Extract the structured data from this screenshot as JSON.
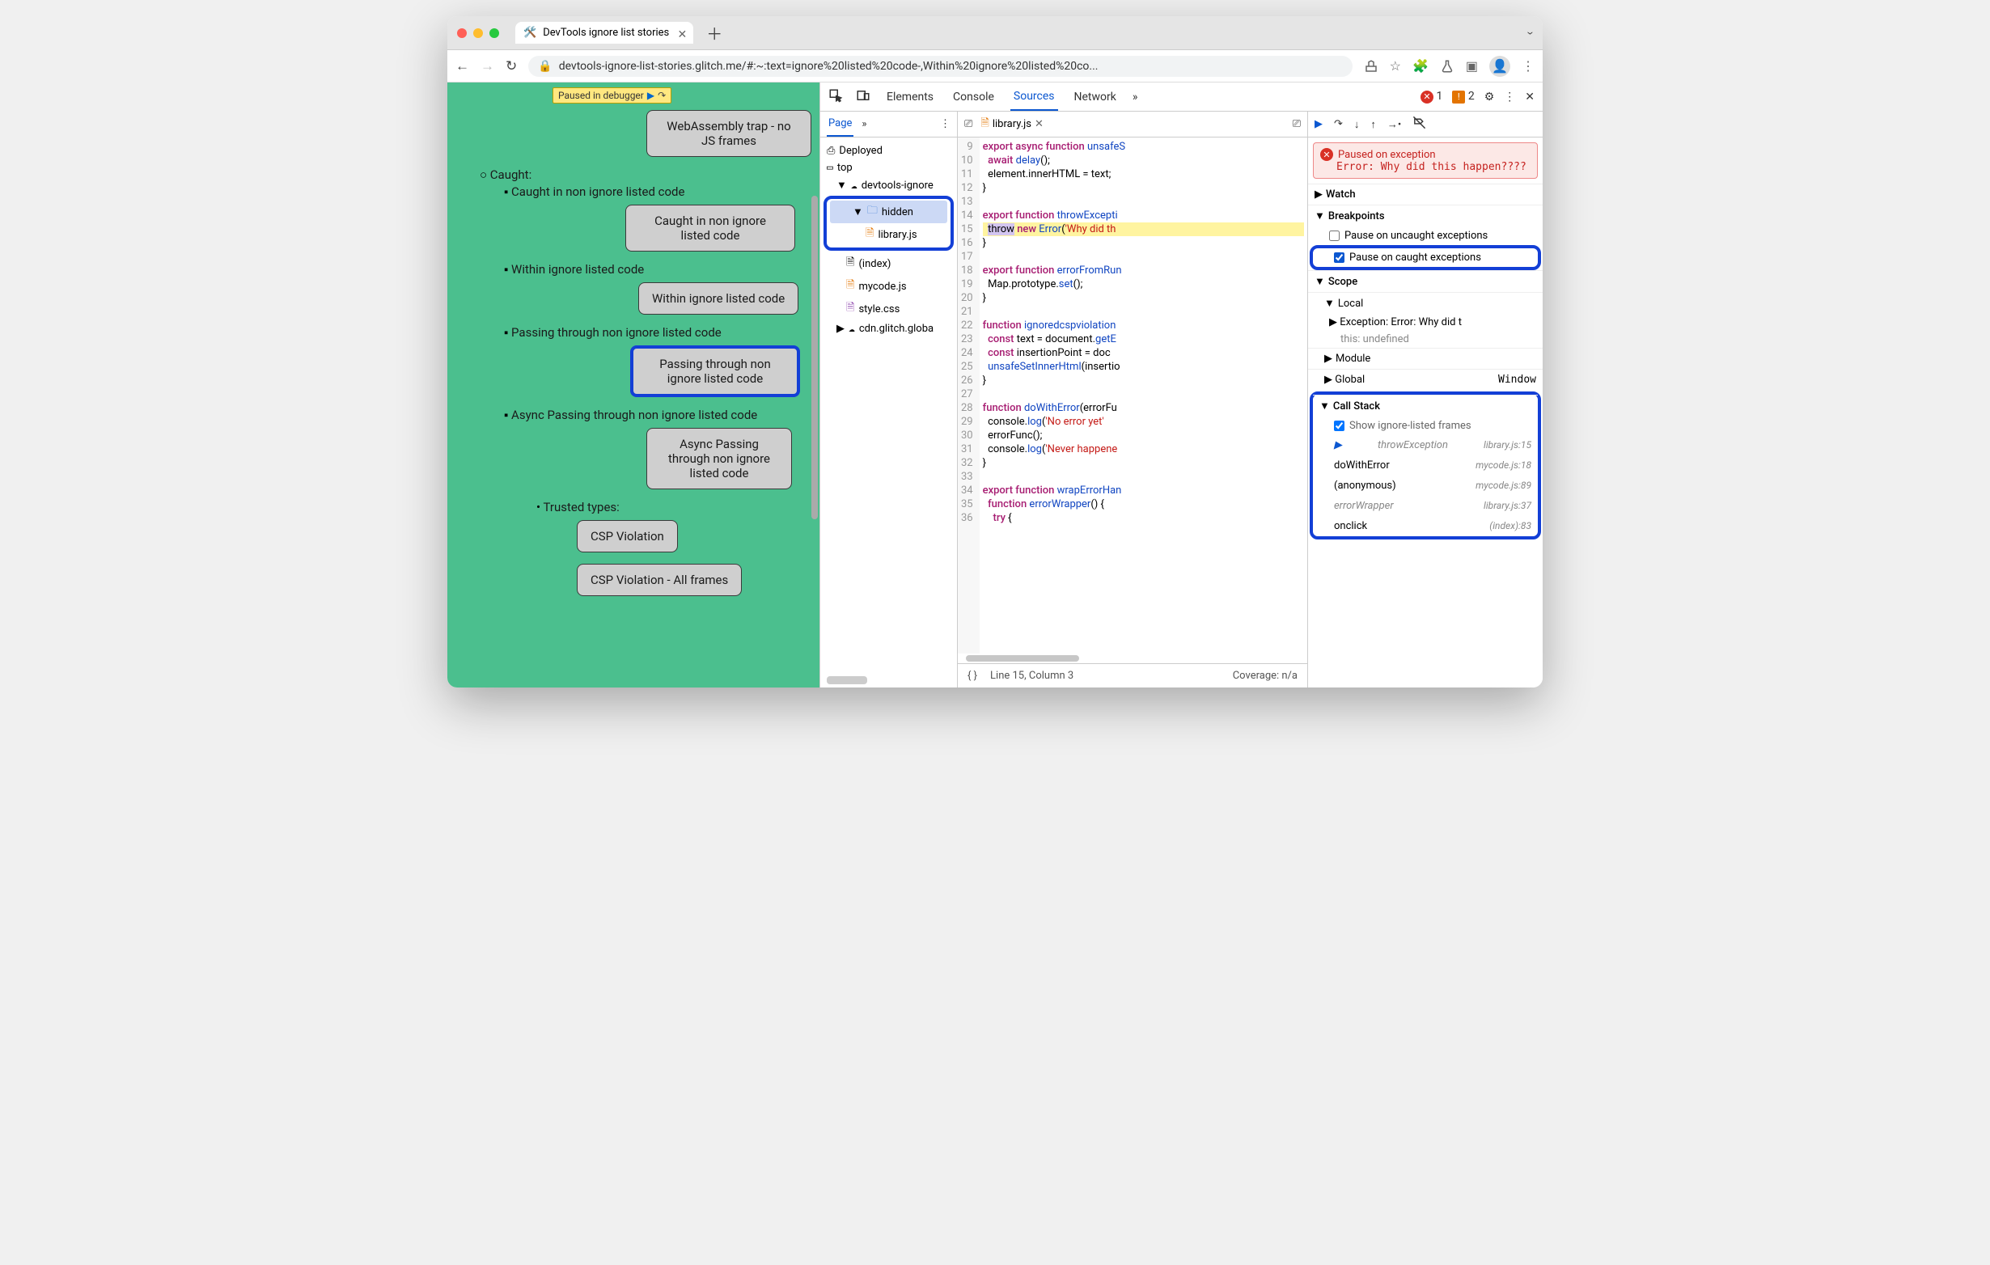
{
  "window": {
    "tab_title": "DevTools ignore list stories",
    "url": "devtools-ignore-list-stories.glitch.me/#:~:text=ignore%20listed%20code-,Within%20ignore%20listed%20co..."
  },
  "paused_overlay": "Paused in debugger",
  "page": {
    "wasm": "WebAssembly trap - no JS frames",
    "caught_hdr": "Caught:",
    "i1_text": "Caught in non ignore listed code",
    "i1_btn": "Caught in non ignore listed code",
    "i2_text": "Within ignore listed code",
    "i2_btn": "Within ignore listed code",
    "i3_text": "Passing through non ignore listed code",
    "i3_btn": "Passing through non ignore listed code",
    "i4_text": "Async Passing through non ignore listed code",
    "i4_btn": "Async Passing through non ignore listed code",
    "tt_hdr": "Trusted types:",
    "tt1": "CSP Violation",
    "tt2": "CSP Violation - All frames"
  },
  "devtools": {
    "tabs": {
      "elements": "Elements",
      "console": "Console",
      "sources": "Sources",
      "network": "Network"
    },
    "errors": "1",
    "warnings": "2"
  },
  "navigator": {
    "page_tab": "Page",
    "deployed": "Deployed",
    "top": "top",
    "origin": "devtools-ignore",
    "hidden": "hidden",
    "library": "library.js",
    "index": "(index)",
    "mycode": "mycode.js",
    "style": "style.css",
    "cdn": "cdn.glitch.globa"
  },
  "editor": {
    "file": "library.js",
    "lines": {
      "9": "export async function unsafeS",
      "10": "  await delay();",
      "11": "  element.innerHTML = text;",
      "12": "}",
      "13": "",
      "14": "export function throwExcepti",
      "15": "  throw new Error('Why did th",
      "16": "}",
      "17": "",
      "18": "export function errorFromRun",
      "19": "  Map.prototype.set();",
      "20": "}",
      "21": "",
      "22": "function ignoredcspviolation",
      "23": "  const text = document.getE",
      "24": "  const insertionPoint = doc",
      "25": "  unsafeSetInnerHtml(insertio",
      "26": "}",
      "27": "",
      "28": "function doWithError(errorFu",
      "29": "  console.log('No error yet'",
      "30": "  errorFunc();",
      "31": "  console.log('Never happene",
      "32": "}",
      "33": "",
      "34": "export function wrapErrorHan",
      "35": "  function errorWrapper() {",
      "36": "    try {"
    },
    "status_line": "Line 15, Column 3",
    "coverage": "Coverage: n/a"
  },
  "debug": {
    "paused_title": "Paused on exception",
    "paused_err": "Error: Why did this happen????",
    "watch": "Watch",
    "breakpoints": "Breakpoints",
    "bp_uncaught": "Pause on uncaught exceptions",
    "bp_caught": "Pause on caught exceptions",
    "scope": "Scope",
    "local": "Local",
    "exception": "Exception: Error: Why did t",
    "this_v": "this: undefined",
    "module": "Module",
    "global": "Global",
    "global_v": "Window",
    "callstack": "Call Stack",
    "showig": "Show ignore-listed frames",
    "frames": [
      {
        "fn": "throwException",
        "loc": "library.js:15",
        "ig": true,
        "cur": true
      },
      {
        "fn": "doWithError",
        "loc": "mycode.js:18",
        "ig": false
      },
      {
        "fn": "(anonymous)",
        "loc": "mycode.js:89",
        "ig": false
      },
      {
        "fn": "errorWrapper",
        "loc": "library.js:37",
        "ig": true
      },
      {
        "fn": "onclick",
        "loc": "(index):83",
        "ig": false
      }
    ]
  }
}
